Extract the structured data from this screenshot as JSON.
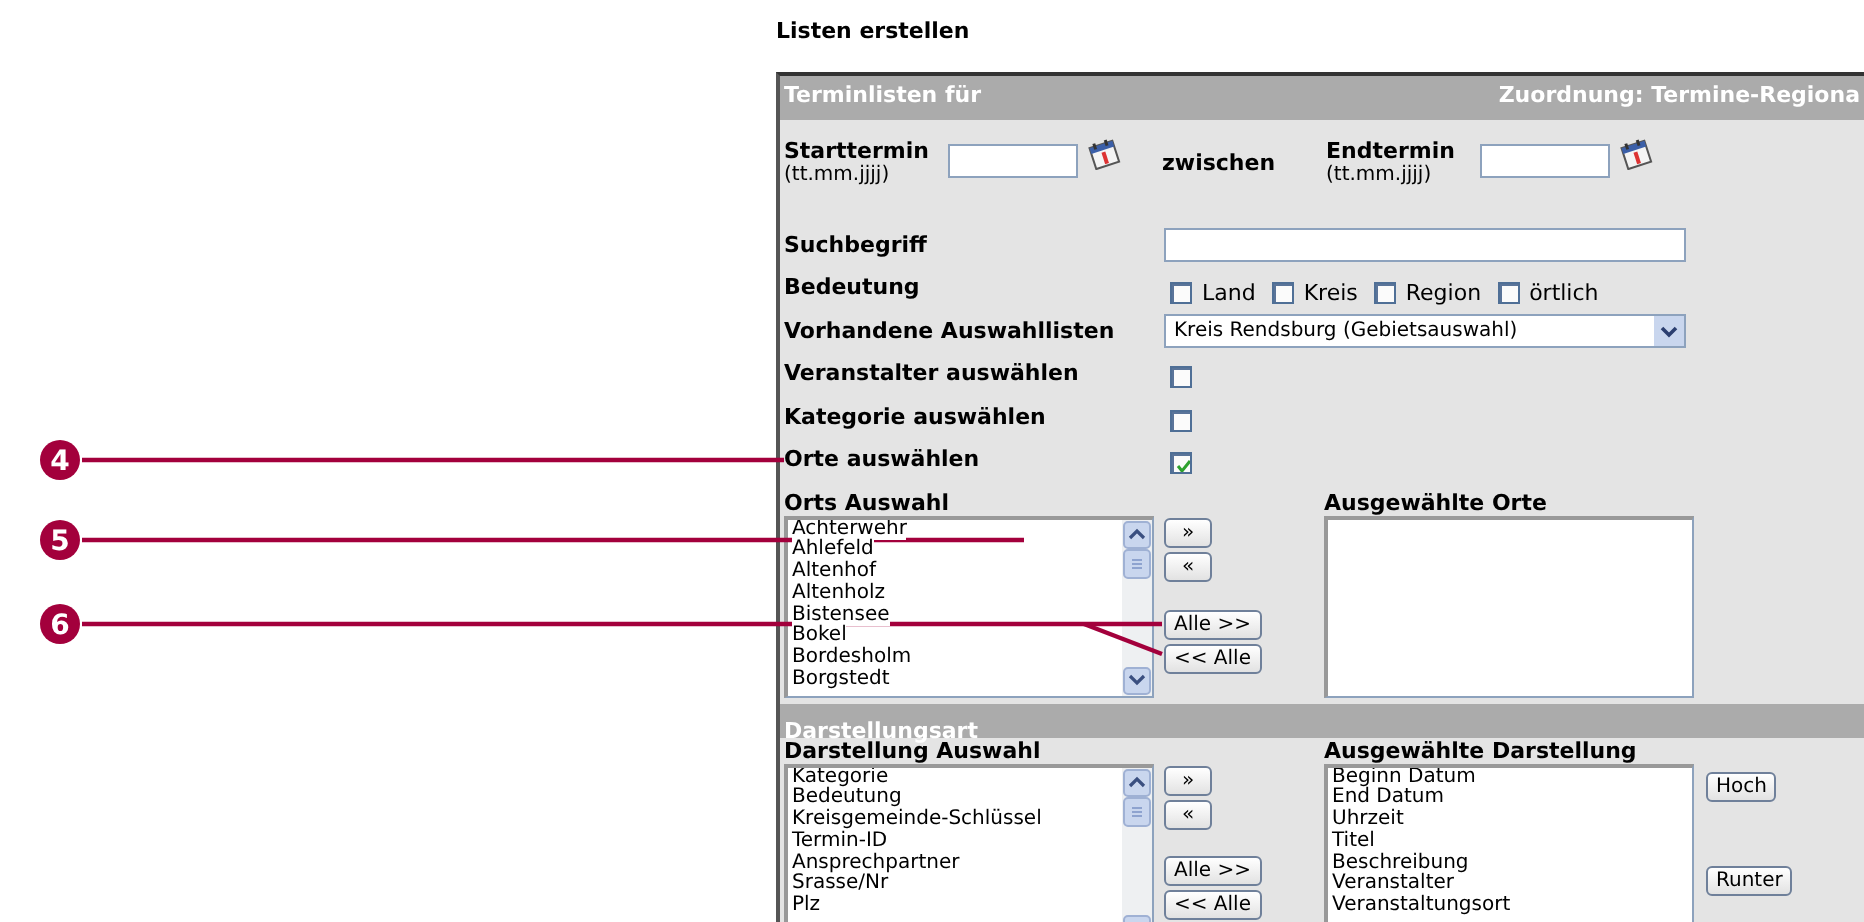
{
  "page_title": "Listen erstellen",
  "panel": {
    "title": "Terminlisten für",
    "assignment": "Zuordnung: Termine-Regiona"
  },
  "dates": {
    "start_label": "Starttermin",
    "start_hint": "(tt.mm.jjjj)",
    "between": "zwischen",
    "end_label": "Endtermin",
    "end_hint": "(tt.mm.jjjj)"
  },
  "search": {
    "label": "Suchbegriff"
  },
  "meaning": {
    "label": "Bedeutung",
    "options": [
      {
        "label": "Land",
        "checked": false
      },
      {
        "label": "Kreis",
        "checked": false
      },
      {
        "label": "Region",
        "checked": false
      },
      {
        "label": "örtlich",
        "checked": false
      }
    ]
  },
  "saved_lists": {
    "label": "Vorhandene Auswahllisten",
    "value": "Kreis Rendsburg (Gebietsauswahl)"
  },
  "toggles": [
    {
      "label": "Veranstalter auswählen",
      "checked": false
    },
    {
      "label": "Kategorie auswählen",
      "checked": false
    },
    {
      "label": "Orte auswählen",
      "checked": true
    }
  ],
  "places": {
    "available_label": "Orts Auswahl",
    "available": [
      "Achterwehr",
      "Ahlefeld",
      "Altenhof",
      "Altenholz",
      "Bistensee",
      "Bokel",
      "Bordesholm",
      "Borgstedt"
    ],
    "buttons": [
      "»",
      "«",
      "Alle >>",
      "<< Alle"
    ],
    "selected_label": "Ausgewählte Orte"
  },
  "display": {
    "title": "Darstellungsart",
    "available_label": "Darstellung Auswahl",
    "available": [
      "Kategorie",
      "Bedeutung",
      "Kreisgemeinde-Schlüssel",
      "Termin-ID",
      "Ansprechpartner",
      "Srasse/Nr",
      "Plz"
    ],
    "buttons": [
      "»",
      "«",
      "Alle >>",
      "<< Alle"
    ],
    "selected_label": "Ausgewählte Darstellung",
    "selected": [
      "Beginn Datum",
      "End Datum",
      "Uhrzeit",
      "Titel",
      "Beschreibung",
      "Veranstalter",
      "Veranstaltungsort"
    ],
    "order_buttons": [
      "Hoch",
      "Runter"
    ]
  },
  "callouts": [
    {
      "number": "4"
    },
    {
      "number": "5"
    },
    {
      "number": "6"
    }
  ]
}
